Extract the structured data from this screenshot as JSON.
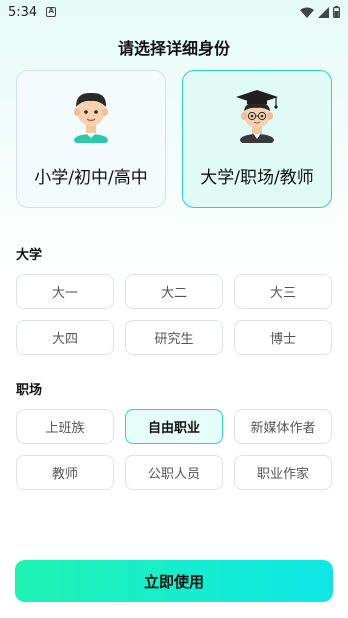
{
  "status_bar": {
    "time": "5:34",
    "notification_icon": "a-box-icon",
    "icons": [
      "wifi-icon",
      "signal-icon",
      "battery-icon"
    ]
  },
  "title": "请选择详细身份",
  "identity_cards": [
    {
      "label": "小学/初中/高中",
      "avatar": "student-boy-avatar",
      "selected": false
    },
    {
      "label": "大学/职场/教师",
      "avatar": "graduate-avatar",
      "selected": true
    }
  ],
  "sections": {
    "university": {
      "title": "大学",
      "options": [
        "大一",
        "大二",
        "大三",
        "大四",
        "研究生",
        "博士"
      ]
    },
    "workplace": {
      "title": "职场",
      "options": [
        "上班族",
        "自由职业",
        "新媒体作者",
        "教师",
        "公职人员",
        "职业作家"
      ],
      "selected": "自由职业"
    }
  },
  "submit_label": "立即使用",
  "colors": {
    "accent_border": "#29d4c9",
    "selected_bg": "#e6fcf8",
    "button_gradient_start": "#1ef3b2",
    "button_gradient_end": "#0fe7e7"
  }
}
